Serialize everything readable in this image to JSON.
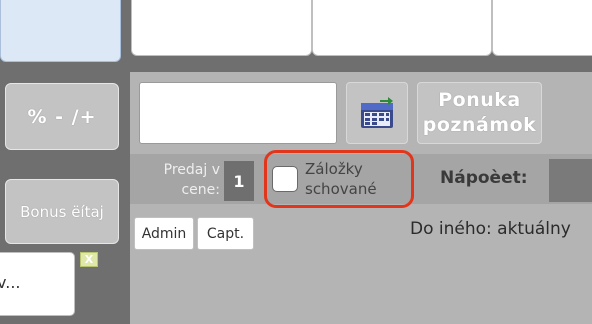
{
  "left_panel": {
    "percent_button": "% - /+",
    "bonus_button": "Bonus ëítaj",
    "note_text": "v...",
    "close_badge": "X"
  },
  "main": {
    "calendar_icon": "calendar-icon",
    "menu_button_line1": "Ponuka",
    "menu_button_line2": "poznámok",
    "price_label_line1": "Predaj v",
    "price_label_line2": "cene:",
    "price_value": "1",
    "bookmarks_label_line1": "Záložky",
    "bookmarks_label_line2": "schované",
    "bookmarks_checked": false,
    "total_label": "Nápoèet:",
    "admin_button": "Admin",
    "capt_button": "Capt.",
    "status_text": "Do iného: aktuálny"
  },
  "colors": {
    "highlight": "#e2361c",
    "background": "#6f6f6f",
    "panel": "#b4b4b4"
  }
}
